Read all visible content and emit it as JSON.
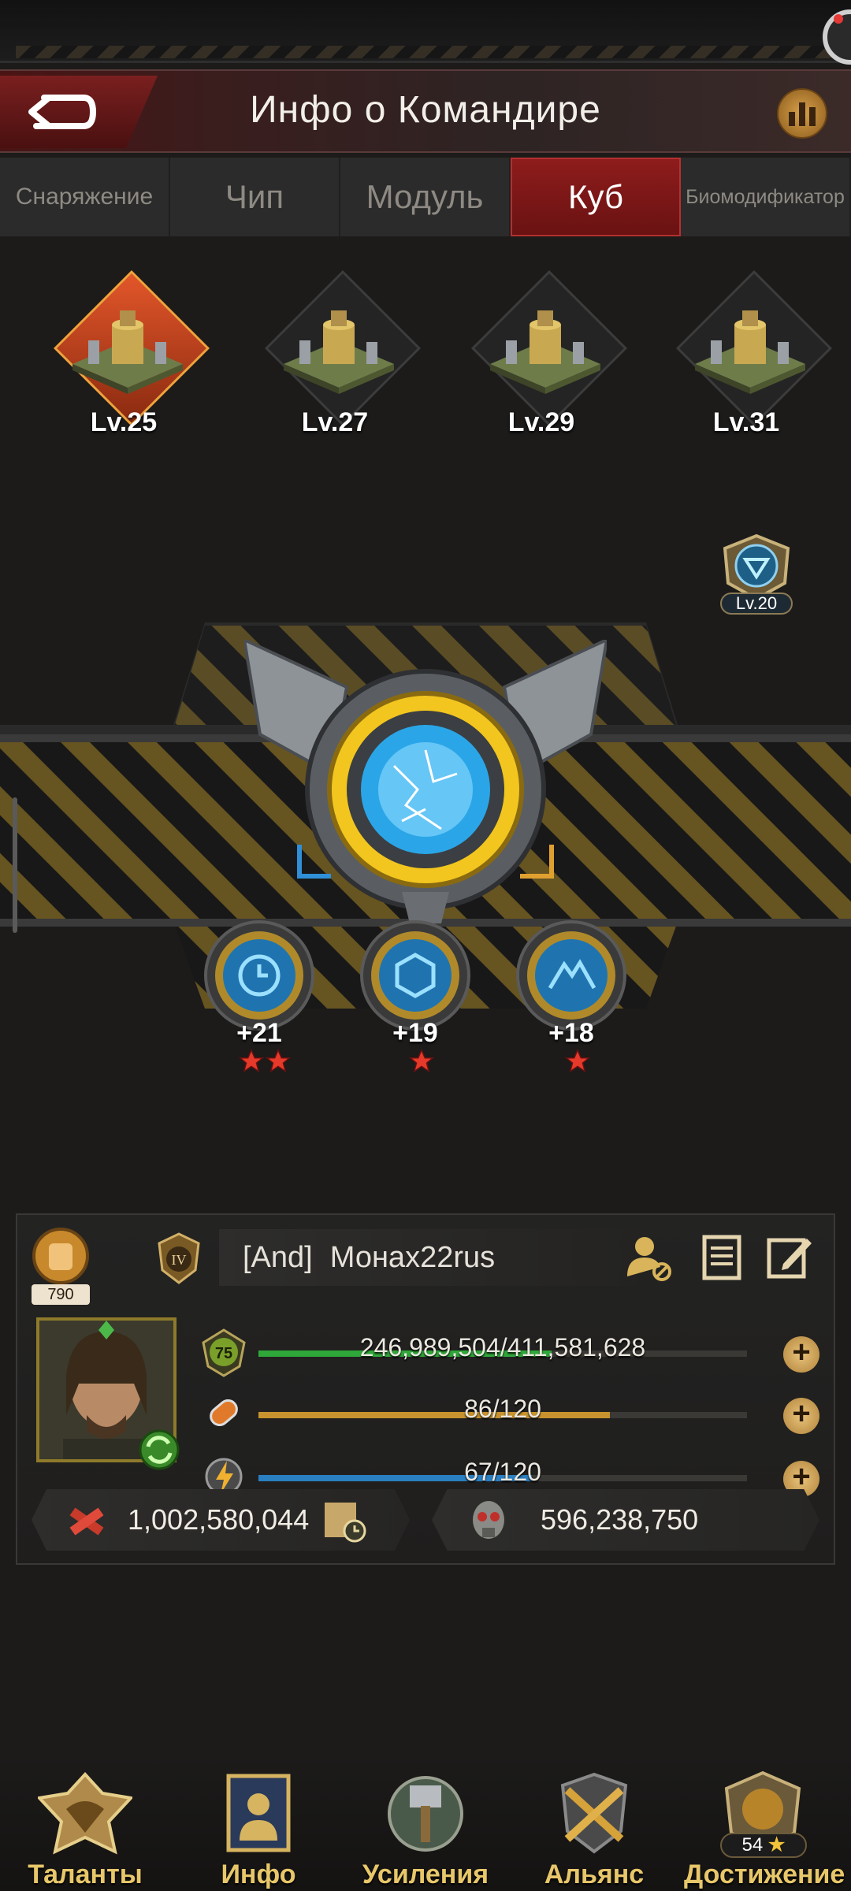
{
  "header": {
    "title": "Инфо о Командире"
  },
  "tabs": [
    {
      "label": "Снаряжение",
      "active": false
    },
    {
      "label": "Чип",
      "active": false
    },
    {
      "label": "Модуль",
      "active": false
    },
    {
      "label": "Куб",
      "active": true
    },
    {
      "label": "Биомодификатор",
      "active": false
    }
  ],
  "cubes": [
    {
      "level": "Lv.25",
      "active": true
    },
    {
      "level": "Lv.27",
      "active": false
    },
    {
      "level": "Lv.29",
      "active": false
    },
    {
      "level": "Lv.31",
      "active": false
    }
  ],
  "side_badge": {
    "level": "Lv.20"
  },
  "sub_cores": [
    {
      "value": "+21",
      "stars": 2,
      "icon": "clock-icon"
    },
    {
      "value": "+19",
      "stars": 1,
      "icon": "hexagon-icon"
    },
    {
      "value": "+18",
      "stars": 1,
      "icon": "mountain-icon"
    }
  ],
  "player": {
    "power_badge": "790",
    "alliance_tag": "[And]",
    "name": "Монах22rus",
    "rank_icon": "rank-iv-icon",
    "level_badge": "75",
    "stats": [
      {
        "text": "246,989,504/411,581,628",
        "fraction": 0.6,
        "color": "#2fa83a",
        "icon": "level-icon"
      },
      {
        "text": "86/120",
        "fraction": 0.72,
        "color": "#c8932e",
        "icon": "stamina-icon"
      },
      {
        "text": "67/120",
        "fraction": 0.56,
        "color": "#2a7fc0",
        "icon": "energy-icon"
      }
    ],
    "kills": "1,002,580,044",
    "deaths": "596,238,750"
  },
  "nav": [
    {
      "label": "Таланты",
      "icon": "talents-icon"
    },
    {
      "label": "Инфо",
      "icon": "info-icon"
    },
    {
      "label": "Усиления",
      "icon": "boosts-icon"
    },
    {
      "label": "Альянс",
      "icon": "alliance-icon"
    },
    {
      "label": "Достижение",
      "icon": "achievement-icon",
      "count": "54"
    }
  ]
}
